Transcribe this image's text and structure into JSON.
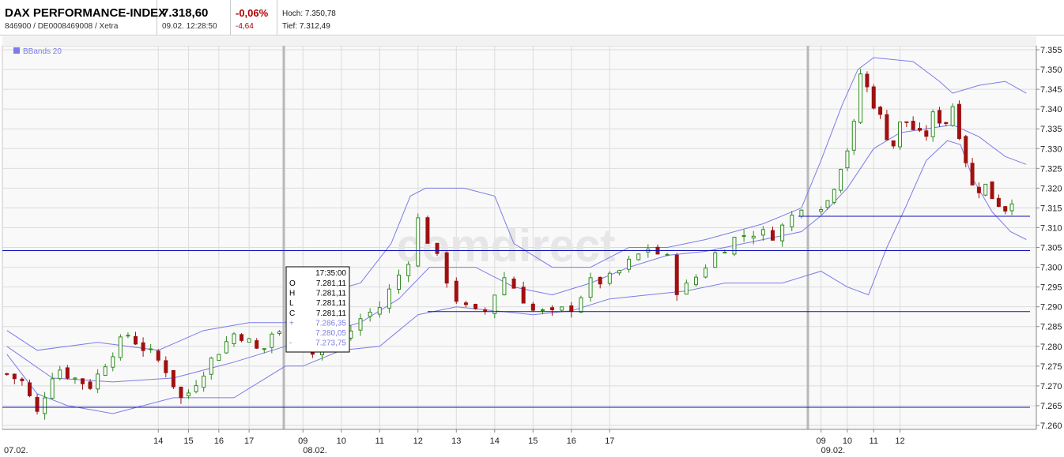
{
  "header": {
    "name": "DAX PERFORMANCE-INDEX",
    "ids": "846900 / DE0008469008 / Xetra",
    "price": "7.318,60",
    "timestamp": "09.02. 12:28:50",
    "change_pct": "-0,06%",
    "change_abs": "-4,64",
    "high": "Hoch: 7.350,78",
    "low": "Tief: 7.312,49"
  },
  "colors": {
    "up": "#2e8b1e",
    "down": "#a01010",
    "band": "#7b7bea",
    "support": "#1010b8",
    "grid": "#dcdcdc",
    "plot_bg": "#f9f9f9"
  },
  "tooltip": {
    "time": "17:35:00",
    "rows": [
      {
        "label": "O",
        "value": "7.281,11"
      },
      {
        "label": "H",
        "value": "7.281,11"
      },
      {
        "label": "L",
        "value": "7.281,11"
      },
      {
        "label": "C",
        "value": "7.281,11"
      },
      {
        "label": "+",
        "value": "7.286,35"
      },
      {
        "label": "",
        "value": "7.280,05"
      },
      {
        "label": "-",
        "value": "7.273,75"
      }
    ]
  },
  "watermark": "comdirect",
  "chart_data": {
    "type": "candlestick",
    "legend": [
      "BBands 20"
    ],
    "legend_position": "top-left",
    "y_axis": {
      "position": "right",
      "range": [
        7259,
        7356
      ],
      "ticks": [
        7355,
        7350,
        7345,
        7340,
        7335,
        7330,
        7325,
        7320,
        7315,
        7310,
        7305,
        7300,
        7295,
        7290,
        7285,
        7280,
        7275,
        7270,
        7265,
        7260
      ],
      "tick_labels": [
        "7.355",
        "7.350",
        "7.345",
        "7.340",
        "7.335",
        "7.330",
        "7.325",
        "7.320",
        "7.315",
        "7.310",
        "7.305",
        "7.300",
        "7.295",
        "7.290",
        "7.285",
        "7.280",
        "7.275",
        "7.270",
        "7.265",
        "7.260"
      ]
    },
    "x_ticks": [
      "14",
      "15",
      "16",
      "17",
      "09",
      "10",
      "11",
      "12",
      "13",
      "14",
      "15",
      "16",
      "17",
      "09",
      "10",
      "11",
      "12"
    ],
    "x_tick_hours": [
      14,
      15,
      16,
      17,
      33,
      34,
      35,
      36,
      37,
      38,
      39,
      40,
      41,
      57,
      58,
      59,
      60
    ],
    "x_range_hours": [
      8.85,
      62.15
    ],
    "day_labels": [
      {
        "label": "07.02.",
        "hour": 8.85
      },
      {
        "label": "08.02.",
        "hour": 33
      },
      {
        "label": "09.02.",
        "hour": 57
      }
    ],
    "day_separators_hours": [
      32.5,
      56.5
    ],
    "grid": true,
    "support_lines": [
      {
        "value": 7264.6,
        "from_hour": 8.85,
        "to_hour": 62.15
      },
      {
        "value": 7288.8,
        "from_hour": 36.25,
        "to_hour": 62.15
      },
      {
        "value": 7304.2,
        "from_hour": 50.0,
        "to_hour": 62.15
      },
      {
        "value": 7312.9,
        "from_hour": 57.0,
        "to_hour": 62.15
      }
    ],
    "close_anchors": [
      [
        9.0,
        7273
      ],
      [
        9.5,
        7271
      ],
      [
        10.0,
        7263
      ],
      [
        10.6,
        7275
      ],
      [
        11.2,
        7272
      ],
      [
        11.8,
        7270
      ],
      [
        12.4,
        7278
      ],
      [
        13.0,
        7283
      ],
      [
        13.6,
        7279
      ],
      [
        14.2,
        7275
      ],
      [
        14.8,
        7266
      ],
      [
        15.4,
        7273
      ],
      [
        16.0,
        7279
      ],
      [
        16.6,
        7284
      ],
      [
        17.0,
        7281
      ],
      [
        17.4,
        7278
      ],
      [
        17.8,
        7284
      ],
      [
        18.2,
        7282
      ],
      [
        33.0,
        7275
      ],
      [
        33.5,
        7283
      ],
      [
        34.0,
        7281
      ],
      [
        34.5,
        7287
      ],
      [
        35.0,
        7290
      ],
      [
        35.5,
        7298
      ],
      [
        35.8,
        7303
      ],
      [
        36.0,
        7312
      ],
      [
        36.3,
        7306
      ],
      [
        36.6,
        7300
      ],
      [
        37.0,
        7292
      ],
      [
        37.4,
        7288
      ],
      [
        37.8,
        7289
      ],
      [
        38.2,
        7298
      ],
      [
        38.6,
        7294
      ],
      [
        39.0,
        7289
      ],
      [
        39.5,
        7288
      ],
      [
        40.0,
        7290
      ],
      [
        40.5,
        7296
      ],
      [
        41.0,
        7297
      ],
      [
        41.5,
        7301
      ],
      [
        42.0,
        7305
      ],
      [
        42.5,
        7302
      ],
      [
        42.8,
        7293
      ],
      [
        43.2,
        7297
      ],
      [
        43.7,
        7303
      ],
      [
        44.2,
        7307
      ],
      [
        44.7,
        7309
      ],
      [
        45.2,
        7308
      ],
      [
        45.6,
        7311
      ],
      [
        46.0,
        7316
      ],
      [
        57.0,
        7313
      ],
      [
        57.4,
        7319
      ],
      [
        57.8,
        7327
      ],
      [
        58.2,
        7333
      ],
      [
        58.5,
        7349
      ],
      [
        58.9,
        7343
      ],
      [
        59.3,
        7337
      ],
      [
        59.7,
        7330
      ],
      [
        60.1,
        7338
      ],
      [
        60.5,
        7335
      ],
      [
        60.9,
        7332
      ],
      [
        61.3,
        7339
      ],
      [
        61.7,
        7336
      ],
      [
        62.0,
        7341
      ],
      [
        62.4,
        7330
      ],
      [
        62.8,
        7319
      ],
      [
        63.2,
        7321
      ],
      [
        63.6,
        7317
      ],
      [
        64.0,
        7315
      ],
      [
        64.4,
        7319
      ]
    ],
    "bbands": {
      "middle": [
        [
          9.0,
          7280
        ],
        [
          10.5,
          7272
        ],
        [
          12.5,
          7271
        ],
        [
          14.5,
          7272
        ],
        [
          16.5,
          7276
        ],
        [
          18.2,
          7280
        ],
        [
          33.0,
          7282
        ],
        [
          34.5,
          7286
        ],
        [
          35.5,
          7292
        ],
        [
          36.3,
          7300
        ],
        [
          37.5,
          7300
        ],
        [
          38.5,
          7295
        ],
        [
          39.5,
          7293
        ],
        [
          40.5,
          7296
        ],
        [
          41.5,
          7300
        ],
        [
          42.5,
          7303
        ],
        [
          43.5,
          7304
        ],
        [
          44.5,
          7306
        ],
        [
          46.0,
          7309
        ],
        [
          57.0,
          7313
        ],
        [
          58.0,
          7320
        ],
        [
          59.0,
          7330
        ],
        [
          60.0,
          7334
        ],
        [
          61.0,
          7335
        ],
        [
          62.0,
          7336
        ],
        [
          63.0,
          7333
        ],
        [
          64.0,
          7328
        ],
        [
          64.8,
          7326
        ]
      ],
      "upper": [
        [
          9.0,
          7284
        ],
        [
          10.0,
          7279
        ],
        [
          12.0,
          7281
        ],
        [
          14.0,
          7279
        ],
        [
          15.5,
          7284
        ],
        [
          17.0,
          7286
        ],
        [
          18.2,
          7286
        ],
        [
          33.0,
          7292
        ],
        [
          34.5,
          7296
        ],
        [
          35.3,
          7306
        ],
        [
          35.8,
          7318
        ],
        [
          36.2,
          7320
        ],
        [
          37.2,
          7320
        ],
        [
          38.0,
          7318
        ],
        [
          38.5,
          7306
        ],
        [
          39.5,
          7300
        ],
        [
          40.5,
          7300
        ],
        [
          41.5,
          7305
        ],
        [
          42.5,
          7305
        ],
        [
          43.5,
          7307
        ],
        [
          45.0,
          7311
        ],
        [
          46.0,
          7315
        ],
        [
          57.0,
          7327
        ],
        [
          57.8,
          7341
        ],
        [
          58.4,
          7350
        ],
        [
          59.0,
          7353
        ],
        [
          60.5,
          7352
        ],
        [
          61.5,
          7347
        ],
        [
          62.0,
          7344
        ],
        [
          63.0,
          7346
        ],
        [
          64.0,
          7347
        ],
        [
          64.8,
          7344
        ]
      ],
      "lower": [
        [
          9.0,
          7278
        ],
        [
          10.0,
          7268
        ],
        [
          11.0,
          7265
        ],
        [
          12.5,
          7263
        ],
        [
          14.5,
          7267
        ],
        [
          16.5,
          7267
        ],
        [
          18.2,
          7275
        ],
        [
          33.0,
          7275
        ],
        [
          34.0,
          7279
        ],
        [
          35.0,
          7280
        ],
        [
          36.0,
          7288
        ],
        [
          37.0,
          7290
        ],
        [
          38.0,
          7289
        ],
        [
          39.0,
          7288
        ],
        [
          40.0,
          7289
        ],
        [
          41.0,
          7292
        ],
        [
          42.0,
          7293
        ],
        [
          43.0,
          7294
        ],
        [
          44.0,
          7296
        ],
        [
          45.5,
          7296
        ],
        [
          57.0,
          7299
        ],
        [
          58.0,
          7295
        ],
        [
          58.8,
          7293
        ],
        [
          59.5,
          7305
        ],
        [
          60.2,
          7315
        ],
        [
          61.0,
          7327
        ],
        [
          61.8,
          7332
        ],
        [
          62.3,
          7331
        ],
        [
          62.8,
          7322
        ],
        [
          63.5,
          7314
        ],
        [
          64.2,
          7309
        ],
        [
          64.8,
          7307
        ]
      ]
    }
  }
}
